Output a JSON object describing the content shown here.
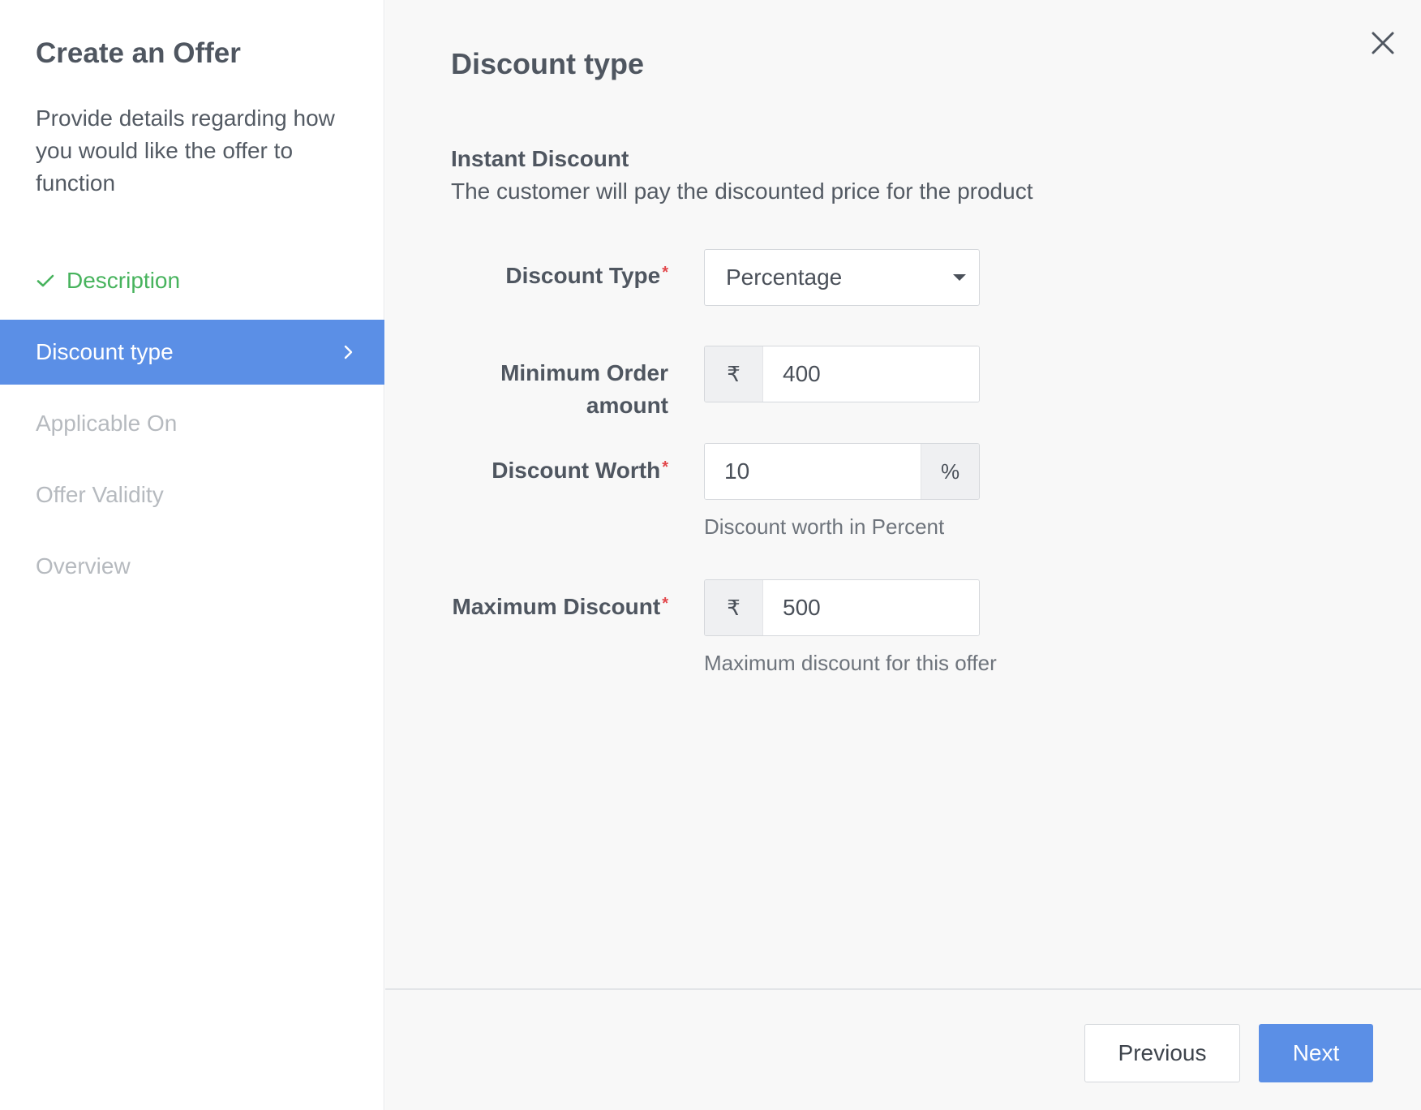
{
  "sidebar": {
    "title": "Create an Offer",
    "description": "Provide details regarding how you would like the offer to function",
    "steps": [
      {
        "label": "Description",
        "state": "completed",
        "icon": "check-icon"
      },
      {
        "label": "Discount type",
        "state": "active",
        "icon": "chevron-right-icon"
      },
      {
        "label": "Applicable On",
        "state": "pending"
      },
      {
        "label": "Offer Validity",
        "state": "pending"
      },
      {
        "label": "Overview",
        "state": "pending"
      }
    ]
  },
  "main": {
    "title": "Discount type",
    "close_icon": "close-icon",
    "section_title": "Instant Discount",
    "section_description": "The customer will pay the discounted price for the product",
    "fields": {
      "discount_type": {
        "label": "Discount Type",
        "required_mark": "*",
        "value": "Percentage"
      },
      "minimum_order": {
        "label_line1": "Minimum Order",
        "label_line2": "amount",
        "prefix": "₹",
        "value": "400"
      },
      "discount_worth": {
        "label": "Discount Worth",
        "required_mark": "*",
        "value": "10",
        "suffix": "%",
        "help": "Discount worth in Percent"
      },
      "maximum_discount": {
        "label": "Maximum Discount",
        "required_mark": "*",
        "prefix": "₹",
        "value": "500",
        "help": "Maximum discount for this offer"
      }
    }
  },
  "footer": {
    "previous_label": "Previous",
    "next_label": "Next"
  },
  "colors": {
    "accent": "#5b8fe6",
    "success": "#47b35d",
    "required": "#e2474b",
    "muted": "#b6babf"
  }
}
